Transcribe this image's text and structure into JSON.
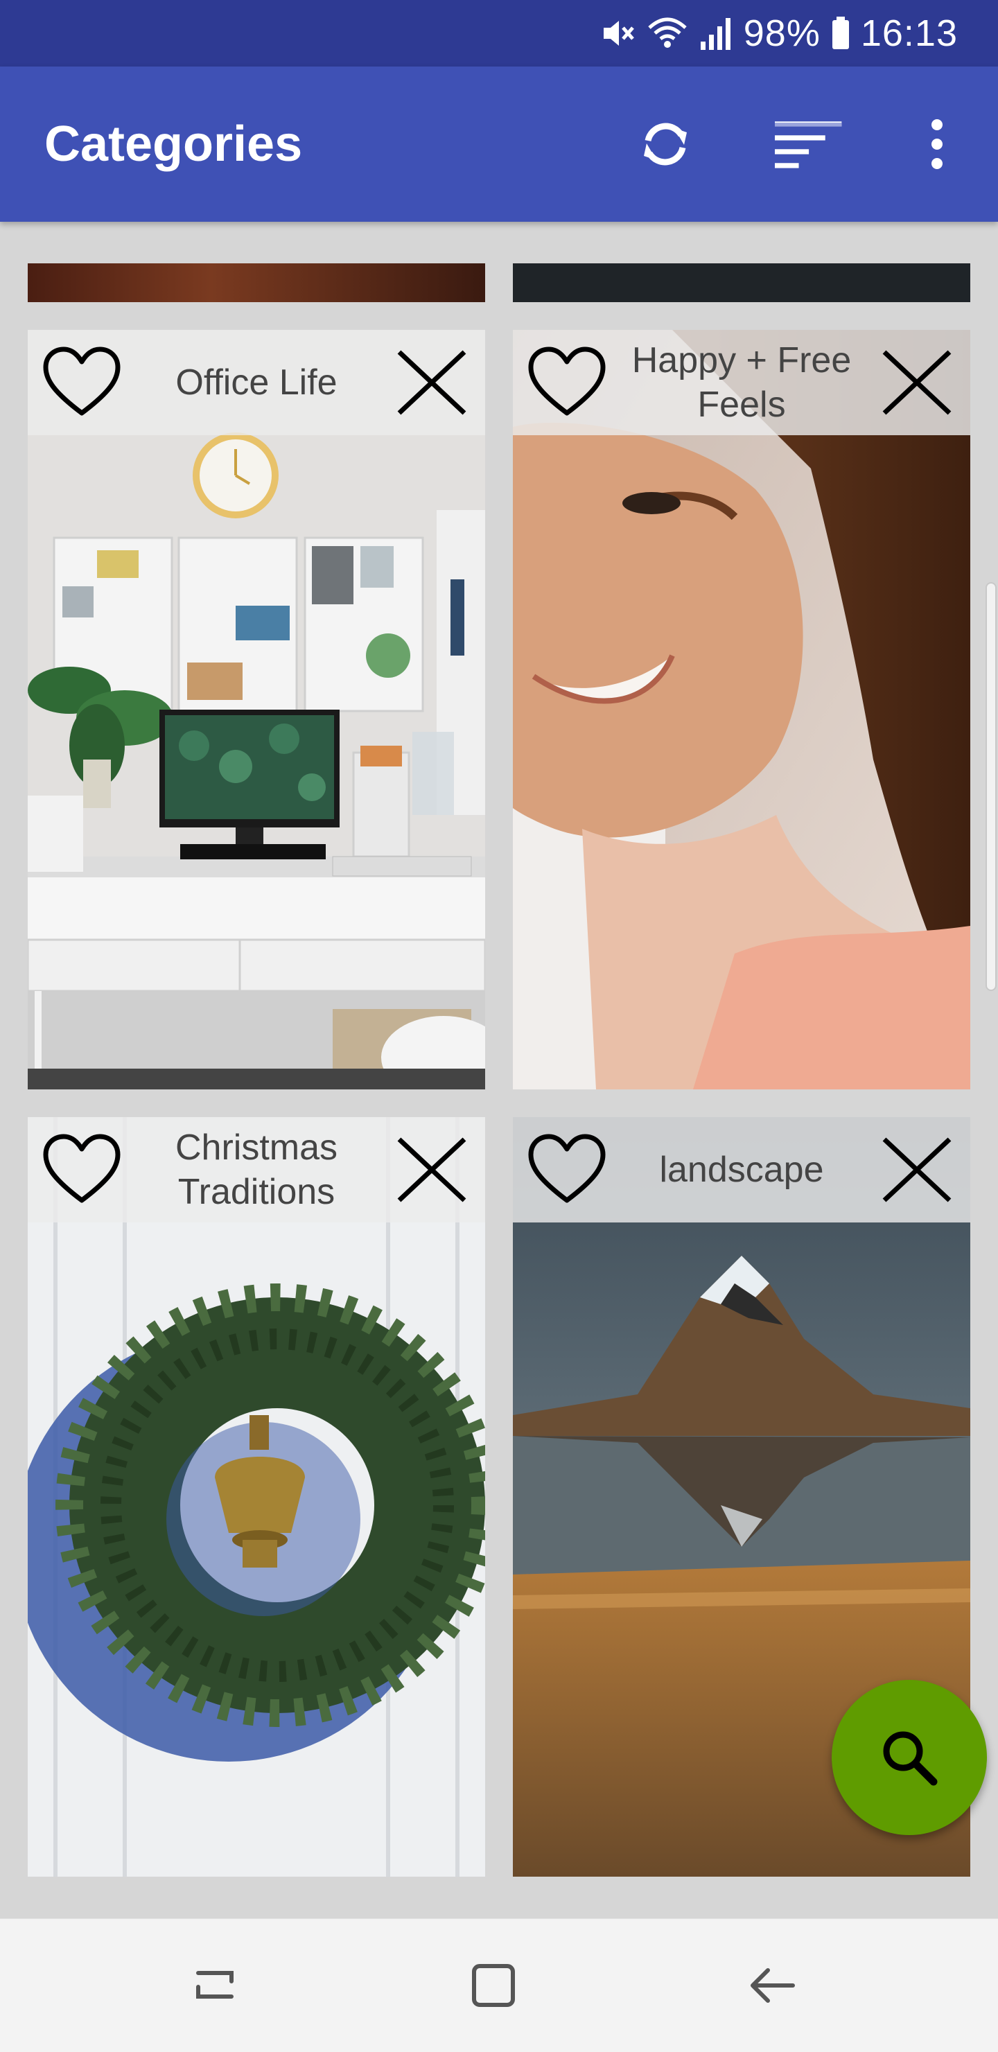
{
  "status_bar": {
    "battery": "98%",
    "time": "16:13"
  },
  "app_bar": {
    "title": "Categories",
    "icons": [
      "refresh-icon",
      "sort-icon",
      "more-vert-icon"
    ]
  },
  "categories": [
    {
      "title": "Office Life",
      "image": "office desk with monitor"
    },
    {
      "title": "Happy + Free Feels",
      "image": "smiling woman"
    },
    {
      "title": "Christmas Traditions",
      "image": "christmas wreath on door"
    },
    {
      "title": "landscape",
      "image": "mountain reflected in lake"
    }
  ],
  "fab": {
    "icon": "search-icon",
    "color": "#5f9c00"
  },
  "colors": {
    "app_bar": "#3f51b5",
    "status_bar": "#2e3a93"
  }
}
